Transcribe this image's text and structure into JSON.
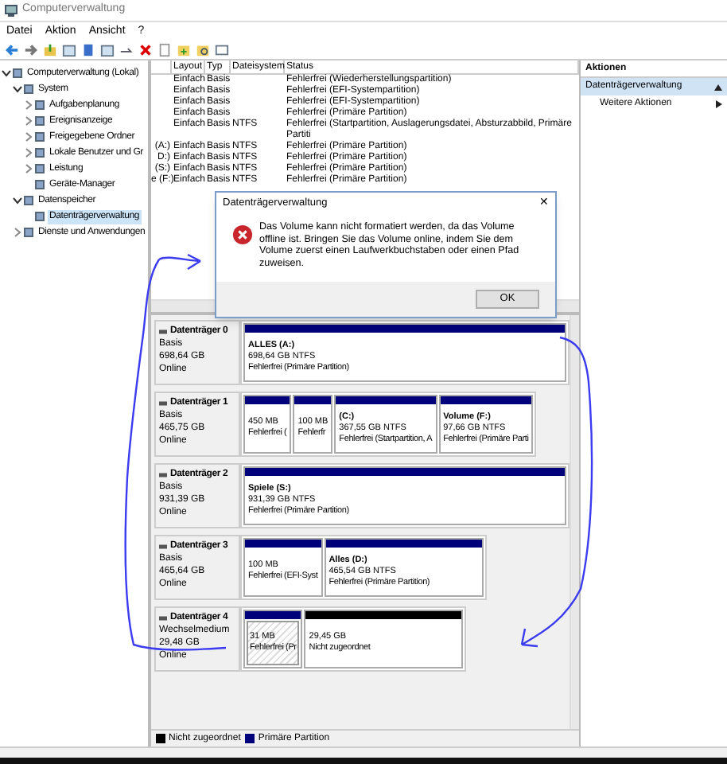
{
  "window": {
    "title": "Computerverwaltung"
  },
  "menu": [
    "Datei",
    "Aktion",
    "Ansicht",
    "?"
  ],
  "tree": [
    {
      "label": "Computerverwaltung (Lokal)",
      "selected": false,
      "expanded": true,
      "children": [
        {
          "label": "System",
          "selected": false,
          "expanded": true,
          "children": [
            {
              "label": "Aufgabenplanung",
              "selected": false,
              "expanded": false
            },
            {
              "label": "Ereignisanzeige",
              "selected": false,
              "expanded": false
            },
            {
              "label": "Freigegebene Ordner",
              "selected": false,
              "expanded": false
            },
            {
              "label": "Lokale Benutzer und Gr",
              "selected": false,
              "expanded": false
            },
            {
              "label": "Leistung",
              "selected": false,
              "expanded": false
            },
            {
              "label": "Geräte-Manager",
              "selected": false
            }
          ]
        },
        {
          "label": "Datenspeicher",
          "selected": false,
          "expanded": true,
          "children": [
            {
              "label": "Datenträgerverwaltung",
              "selected": true
            }
          ]
        },
        {
          "label": "Dienste und Anwendungen",
          "selected": false,
          "expanded": false
        }
      ]
    }
  ],
  "volume_table": {
    "columns": [
      "Layout",
      "Typ",
      "Dateisystem",
      "Status"
    ],
    "rows": [
      {
        "cells": [
          "Einfach",
          "Basis",
          "",
          "Fehlerfrei (Wiederherstellungspartition)"
        ]
      },
      {
        "cells": [
          "Einfach",
          "Basis",
          "",
          "Fehlerfrei (EFI-Systempartition)"
        ]
      },
      {
        "cells": [
          "Einfach",
          "Basis",
          "",
          "Fehlerfrei (EFI-Systempartition)"
        ]
      },
      {
        "cells": [
          "Einfach",
          "Basis",
          "",
          "Fehlerfrei (Primäre Partition)"
        ]
      },
      {
        "cells": [
          "Einfach",
          "Basis",
          "NTFS",
          "Fehlerfrei (Startpartition, Auslagerungsdatei, Absturzabbild, Primäre Partiti"
        ]
      },
      {
        "volume": "(A:)",
        "cells": [
          "Einfach",
          "Basis",
          "NTFS",
          "Fehlerfrei (Primäre Partition)"
        ]
      },
      {
        "volume": "D:)",
        "cells": [
          "Einfach",
          "Basis",
          "NTFS",
          "Fehlerfrei (Primäre Partition)"
        ]
      },
      {
        "volume": "(S:)",
        "cells": [
          "Einfach",
          "Basis",
          "NTFS",
          "Fehlerfrei (Primäre Partition)"
        ]
      },
      {
        "volume": "e (F:)",
        "cells": [
          "Einfach",
          "Basis",
          "NTFS",
          "Fehlerfrei (Primäre Partition)"
        ]
      }
    ]
  },
  "disks": [
    {
      "name": "Datenträger 0",
      "type": "Basis",
      "size": "698,64 GB",
      "state": "Online",
      "partitions": [
        {
          "kind": "primary",
          "selected": false,
          "name": "ALLES  (A:)",
          "size": "698,64 GB NTFS",
          "status": "Fehlerfrei (Primäre Partition)"
        }
      ]
    },
    {
      "name": "Datenträger 1",
      "type": "Basis",
      "size": "465,75 GB",
      "state": "Online",
      "partitions": [
        {
          "kind": "primary",
          "selected": false,
          "size": "450 MB",
          "status": "Fehlerfrei ("
        },
        {
          "kind": "primary",
          "selected": false,
          "size": "100 MB",
          "status": "Fehlerfr"
        },
        {
          "kind": "primary",
          "selected": false,
          "name": "(C:)",
          "size": "367,55 GB NTFS",
          "status": "Fehlerfrei (Startpartition, A"
        },
        {
          "kind": "primary",
          "selected": false,
          "name": "Volume  (F:)",
          "size": "97,66 GB NTFS",
          "status": "Fehlerfrei (Primäre Parti"
        }
      ]
    },
    {
      "name": "Datenträger 2",
      "type": "Basis",
      "size": "931,39 GB",
      "state": "Online",
      "partitions": [
        {
          "kind": "primary",
          "selected": false,
          "name": "Spiele  (S:)",
          "size": "931,39 GB NTFS",
          "status": "Fehlerfrei (Primäre Partition)"
        }
      ]
    },
    {
      "name": "Datenträger 3",
      "type": "Basis",
      "size": "465,64 GB",
      "state": "Online",
      "partitions": [
        {
          "kind": "primary",
          "selected": false,
          "size": "100 MB",
          "status": "Fehlerfrei (EFI-Syst"
        },
        {
          "kind": "primary",
          "selected": false,
          "name": "Alles  (D:)",
          "size": "465,54 GB NTFS",
          "status": "Fehlerfrei (Primäre Partition)"
        }
      ]
    },
    {
      "name": "Datenträger 4",
      "type": "Wechselmedium",
      "size": "29,48 GB",
      "state": "Online",
      "partitions": [
        {
          "kind": "primary",
          "selected": true,
          "size": "31 MB",
          "status": "Fehlerfrei (Pr"
        },
        {
          "kind": "unallocated",
          "selected": false,
          "size": "29,45 GB",
          "status": "Nicht zugeordnet"
        }
      ]
    }
  ],
  "legend": [
    {
      "label": "Nicht zugeordnet",
      "color": "#000000"
    },
    {
      "label": "Primäre Partition",
      "color": "#00007a"
    }
  ],
  "actions": {
    "title": "Aktionen",
    "items": [
      {
        "label": "Datenträgerverwaltung",
        "kind": "header"
      },
      {
        "label": "Weitere Aktionen",
        "kind": "item"
      }
    ]
  },
  "dialog": {
    "title": "Datenträgerverwaltung",
    "close": "✕",
    "message": "Das Volume kann nicht formatiert werden, da das Volume offline ist. Bringen Sie das Volume online, indem Sie dem Volume zuerst einen Laufwerkbuchstaben oder einen Pfad zuweisen.",
    "button": "OK"
  }
}
